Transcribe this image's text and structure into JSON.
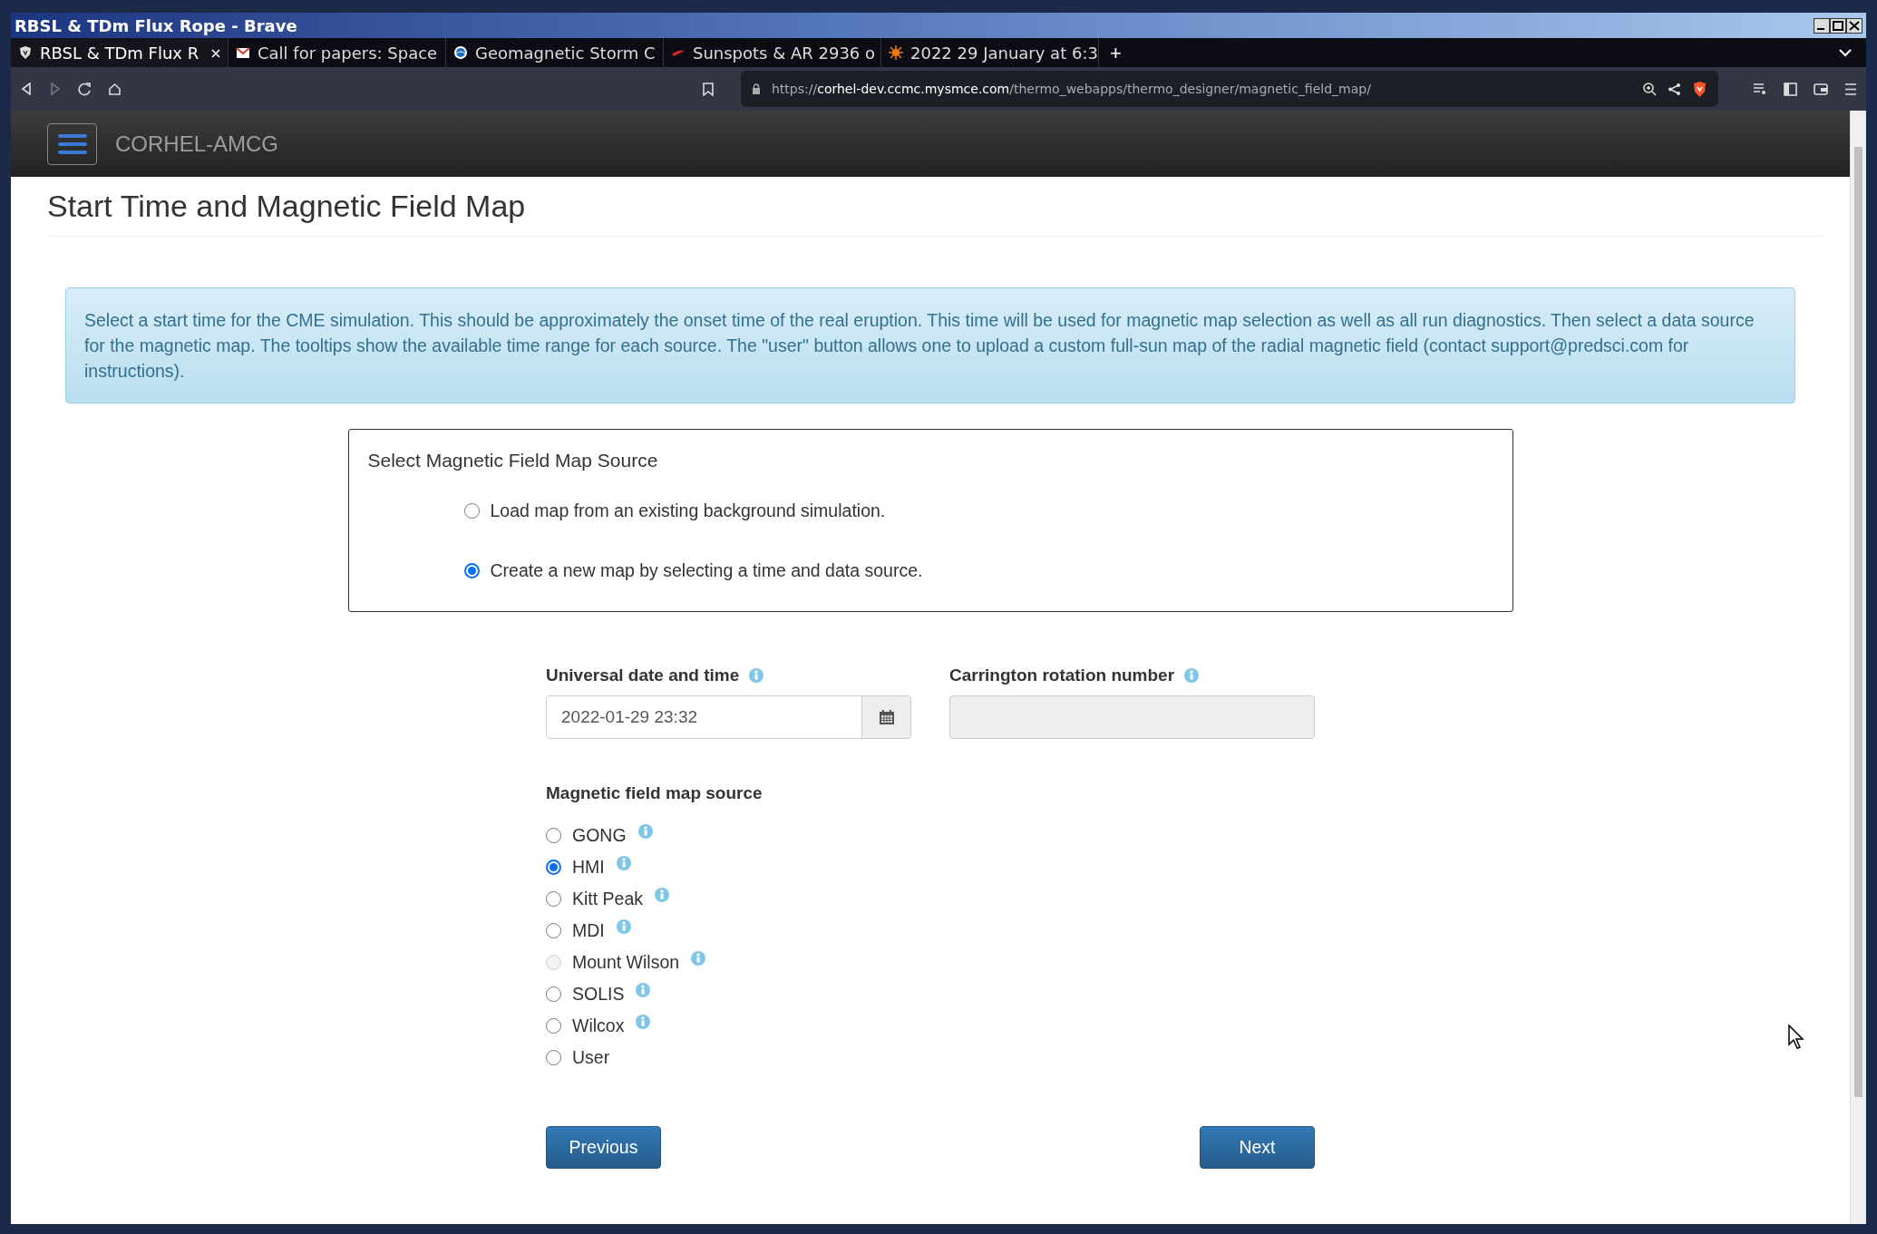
{
  "window": {
    "title": "RBSL & TDm Flux Rope - Brave"
  },
  "tabs": [
    {
      "label": "RBSL & TDm Flux R",
      "selected": true
    },
    {
      "label": "Call for papers: Space",
      "selected": false
    },
    {
      "label": "Geomagnetic Storm C",
      "selected": false
    },
    {
      "label": "Sunspots & AR 2936 o",
      "selected": false
    },
    {
      "label": "2022 29 January at 6:3",
      "selected": false
    }
  ],
  "new_tab": "+",
  "address": {
    "scheme": "https://",
    "host": "corhel-dev.ccmc.mysmce.com",
    "path": "/thermo_webapps/thermo_designer/magnetic_field_map/"
  },
  "navbar": {
    "brand": "CORHEL-AMCG"
  },
  "page": {
    "title": "Start Time and Magnetic Field Map",
    "info": "Select a start time for the CME simulation. This should be approximately the onset time of the real eruption. This time will be used for magnetic map selection as well as all run diagnostics. Then select a data source for the magnetic map. The tooltips show the available time range for each source. The \"user\" button allows one to upload a custom full-sun map of the radial magnetic field (contact support@predsci.com for instructions).",
    "source_panel": {
      "title": "Select Magnetic Field Map Source",
      "options": [
        {
          "label": "Load map from an existing background simulation.",
          "selected": false
        },
        {
          "label": "Create a new map by selecting a time and data source.",
          "selected": true
        }
      ]
    },
    "datetime": {
      "label": "Universal date and time",
      "value": "2022-01-29 23:32"
    },
    "carrington": {
      "label": "Carrington rotation number",
      "disabled": true
    },
    "map_source": {
      "label": "Magnetic field map source",
      "options": [
        {
          "label": "GONG",
          "selected": false,
          "disabled": false,
          "has_info": true
        },
        {
          "label": "HMI",
          "selected": true,
          "disabled": false,
          "has_info": true
        },
        {
          "label": "Kitt Peak",
          "selected": false,
          "disabled": false,
          "has_info": true
        },
        {
          "label": "MDI",
          "selected": false,
          "disabled": false,
          "has_info": true
        },
        {
          "label": "Mount Wilson",
          "selected": false,
          "disabled": true,
          "has_info": true
        },
        {
          "label": "SOLIS",
          "selected": false,
          "disabled": false,
          "has_info": true
        },
        {
          "label": "Wilcox",
          "selected": false,
          "disabled": false,
          "has_info": true
        },
        {
          "label": "User",
          "selected": false,
          "disabled": false,
          "has_info": false
        }
      ]
    },
    "buttons": {
      "previous": "Previous",
      "next": "Next"
    }
  }
}
